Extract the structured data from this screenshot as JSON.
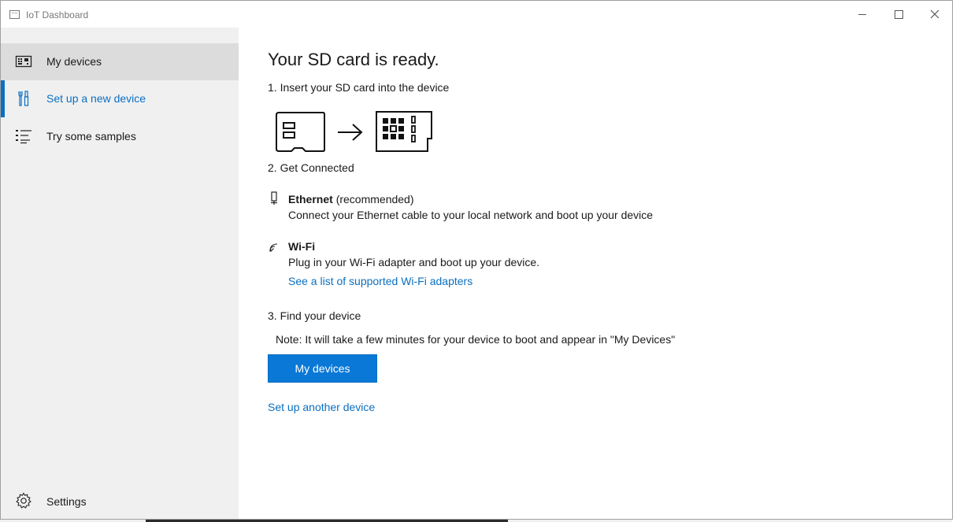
{
  "window": {
    "title": "IoT Dashboard",
    "controls": {
      "minimize": "minimize",
      "maximize": "maximize",
      "close": "close"
    }
  },
  "sidebar": {
    "items": [
      {
        "label": "My devices",
        "icon": "device-board-icon",
        "selected": false,
        "hovered": true
      },
      {
        "label": "Set up a new device",
        "icon": "tools-icon",
        "selected": true
      },
      {
        "label": "Try some samples",
        "icon": "list-icon",
        "selected": false
      }
    ],
    "settings": {
      "label": "Settings",
      "icon": "gear-icon"
    }
  },
  "main": {
    "heading": "Your SD card is ready.",
    "step1": "1. Insert your SD card into the device",
    "step2": "2. Get Connected",
    "ethernet": {
      "title": "Ethernet",
      "qualifier": "(recommended)",
      "description": "Connect your Ethernet cable to your local network and boot up your device"
    },
    "wifi": {
      "title": "Wi-Fi",
      "description": "Plug in your Wi-Fi adapter and boot up your device.",
      "link": "See a list of supported Wi-Fi adapters"
    },
    "step3": "3. Find your device",
    "note": "Note: It will take a few minutes for your device to boot and appear in \"My Devices\"",
    "primary_button": "My devices",
    "secondary_link": "Set up another device"
  },
  "colors": {
    "accent": "#0a78d7",
    "link": "#0a6fc2",
    "sidebar_bg": "#f0f0f0",
    "selected_bg": "#dcdcdc"
  }
}
